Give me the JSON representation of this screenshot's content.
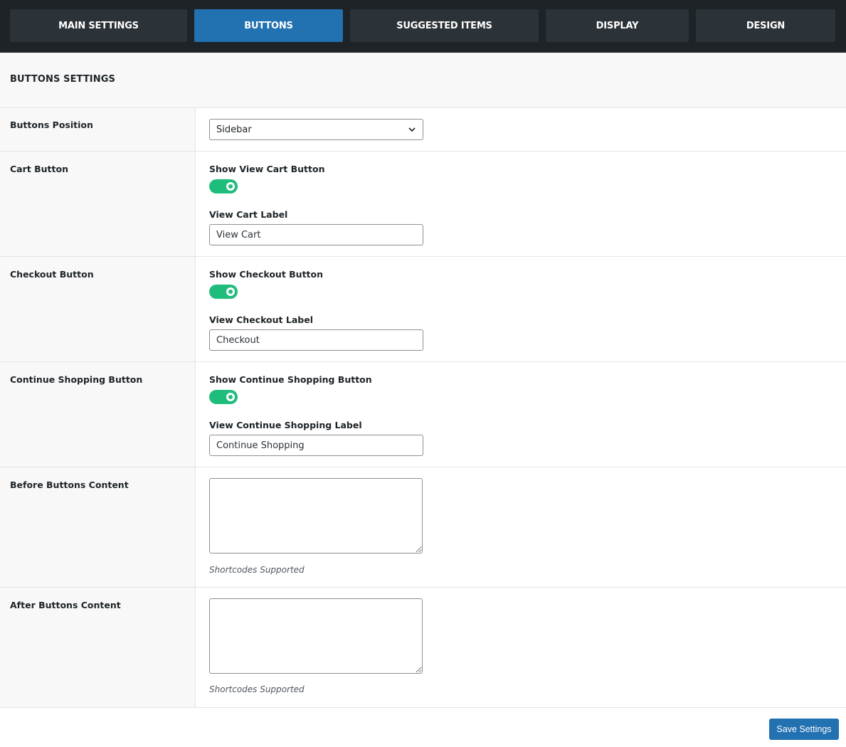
{
  "tabs": [
    {
      "label": "MAIN SETTINGS",
      "active": false
    },
    {
      "label": "BUTTONS",
      "active": true
    },
    {
      "label": "SUGGESTED ITEMS",
      "active": false
    },
    {
      "label": "DISPLAY",
      "active": false
    },
    {
      "label": "DESIGN",
      "active": false
    }
  ],
  "section": {
    "title": "BUTTONS SETTINGS"
  },
  "rows": {
    "buttons_position": {
      "label": "Buttons Position",
      "select_value": "Sidebar"
    },
    "cart_button": {
      "label": "Cart Button",
      "toggle_label": "Show View Cart Button",
      "toggle_on": true,
      "input_label": "View Cart Label",
      "input_value": "View Cart"
    },
    "checkout_button": {
      "label": "Checkout Button",
      "toggle_label": "Show Checkout Button",
      "toggle_on": true,
      "input_label": "View Checkout Label",
      "input_value": "Checkout"
    },
    "continue_button": {
      "label": "Continue Shopping Button",
      "toggle_label": "Show Continue Shopping Button",
      "toggle_on": true,
      "input_label": "View Continue Shopping Label",
      "input_value": "Continue Shopping"
    },
    "before_content": {
      "label": "Before Buttons Content",
      "value": "",
      "hint": "Shortcodes Supported"
    },
    "after_content": {
      "label": "After Buttons Content",
      "value": "",
      "hint": "Shortcodes Supported"
    }
  },
  "save_label": "Save Settings",
  "colors": {
    "tab_bar": "#1d2327",
    "tab": "#2c3338",
    "tab_active": "#2271b1",
    "toggle_on": "#1fbd7b",
    "primary_button": "#2271b1"
  },
  "icons": {
    "select_chevron": "chevron-down-icon",
    "textarea_grip": "resize-grip-icon"
  }
}
